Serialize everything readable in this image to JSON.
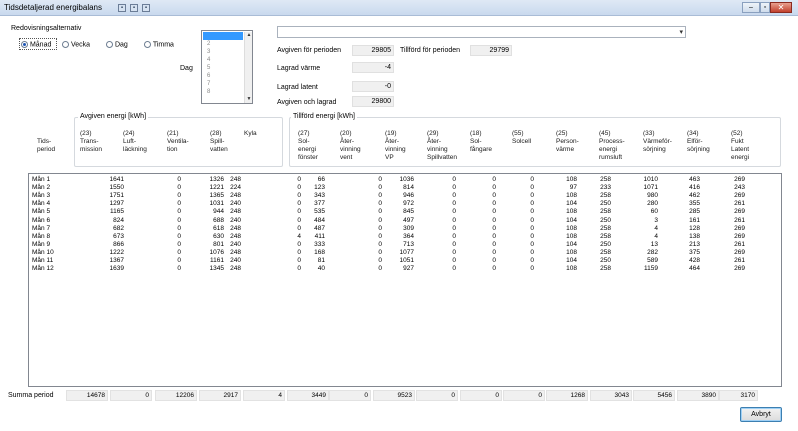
{
  "window": {
    "title": "Tidsdetaljerad energibalans",
    "close_glyph": "✕"
  },
  "options": {
    "group_label": "Redovisningsalternativ",
    "radios": [
      {
        "label": "Månad",
        "selected": true
      },
      {
        "label": "Vecka",
        "selected": false
      },
      {
        "label": "Dag",
        "selected": false
      },
      {
        "label": "Timma",
        "selected": false
      }
    ],
    "day_label": "Dag",
    "day_items": [
      "2",
      "3",
      "4",
      "5",
      "6",
      "7",
      "8"
    ]
  },
  "summary": {
    "avgiven_label": "Avgiven för perioden",
    "avgiven_value": "29805",
    "tillford_label": "Tillförd för perioden",
    "tillford_value": "29799",
    "lagrad_varme_label": "Lagrad värme",
    "lagrad_varme_value": "-4",
    "lagrad_latent_label": "Lagrad latent",
    "lagrad_latent_value": "-0",
    "avgiven_lagrad_label": "Avgiven och lagrad",
    "avgiven_lagrad_value": "29800"
  },
  "headers": {
    "avgiven_group": "Avgiven energi [kWh]",
    "tillford_group": "Tillförd energi [kWh]",
    "period": "Tids-\nperiod",
    "columns": [
      "(23)\nTrans-\nmission",
      "(24)\nLuft-\nläckning",
      "(21)\nVentila-\ntion",
      "(28)\nSpill-\nvatten",
      "Kyla",
      "(27)\nSol-\nenergi\nfönster",
      "(20)\nÅter-\nvinning\nvent",
      "(19)\nÅter-\nvinning\nVP",
      "(29)\nÅter-\nvinning\nSpillvatten",
      "(18)\nSol-\nfångare",
      "(55)\nSolcell",
      "(25)\nPerson-\nvärme",
      "(45)\nProcess-\nenergi\nrumsluft",
      "(33)\nVärmeför-\nsörjning",
      "(34)\nElför-\nsörjning",
      "(52)\nFukt\nLatent\nenergi"
    ]
  },
  "rows": [
    {
      "period": "Mån 1",
      "values": [
        "1641",
        "0",
        "1326",
        "248",
        "0",
        "66",
        "0",
        "1036",
        "0",
        "0",
        "0",
        "108",
        "258",
        "1010",
        "463",
        "269"
      ]
    },
    {
      "period": "Mån 2",
      "values": [
        "1550",
        "0",
        "1221",
        "224",
        "0",
        "123",
        "0",
        "814",
        "0",
        "0",
        "0",
        "97",
        "233",
        "1071",
        "416",
        "243"
      ]
    },
    {
      "period": "Mån 3",
      "values": [
        "1751",
        "0",
        "1365",
        "248",
        "0",
        "343",
        "0",
        "946",
        "0",
        "0",
        "0",
        "108",
        "258",
        "980",
        "462",
        "269"
      ]
    },
    {
      "period": "Mån 4",
      "values": [
        "1297",
        "0",
        "1031",
        "240",
        "0",
        "377",
        "0",
        "972",
        "0",
        "0",
        "0",
        "104",
        "250",
        "280",
        "355",
        "261"
      ]
    },
    {
      "period": "Mån 5",
      "values": [
        "1165",
        "0",
        "944",
        "248",
        "0",
        "535",
        "0",
        "845",
        "0",
        "0",
        "0",
        "108",
        "258",
        "60",
        "285",
        "269"
      ]
    },
    {
      "period": "Mån 6",
      "values": [
        "824",
        "0",
        "688",
        "240",
        "0",
        "484",
        "0",
        "497",
        "0",
        "0",
        "0",
        "104",
        "250",
        "3",
        "161",
        "261"
      ]
    },
    {
      "period": "Mån 7",
      "values": [
        "682",
        "0",
        "618",
        "248",
        "0",
        "487",
        "0",
        "309",
        "0",
        "0",
        "0",
        "108",
        "258",
        "4",
        "128",
        "269"
      ]
    },
    {
      "period": "Mån 8",
      "values": [
        "673",
        "0",
        "630",
        "248",
        "4",
        "411",
        "0",
        "364",
        "0",
        "0",
        "0",
        "108",
        "258",
        "4",
        "138",
        "269"
      ]
    },
    {
      "period": "Mån 9",
      "values": [
        "866",
        "0",
        "801",
        "240",
        "0",
        "333",
        "0",
        "713",
        "0",
        "0",
        "0",
        "104",
        "250",
        "13",
        "213",
        "261"
      ]
    },
    {
      "period": "Mån 10",
      "values": [
        "1222",
        "0",
        "1076",
        "248",
        "0",
        "168",
        "0",
        "1077",
        "0",
        "0",
        "0",
        "108",
        "258",
        "282",
        "375",
        "269"
      ]
    },
    {
      "period": "Mån 11",
      "values": [
        "1367",
        "0",
        "1161",
        "240",
        "0",
        "81",
        "0",
        "1051",
        "0",
        "0",
        "0",
        "104",
        "250",
        "589",
        "428",
        "261"
      ]
    },
    {
      "period": "Mån 12",
      "values": [
        "1639",
        "0",
        "1345",
        "248",
        "0",
        "40",
        "0",
        "927",
        "0",
        "0",
        "0",
        "108",
        "258",
        "1159",
        "464",
        "269"
      ]
    }
  ],
  "totals": {
    "label": "Summa period",
    "values": [
      "14678",
      "0",
      "12206",
      "2917",
      "4",
      "3449",
      "0",
      "9523",
      "0",
      "0",
      "0",
      "1268",
      "3043",
      "5456",
      "3890",
      "3170"
    ]
  },
  "buttons": {
    "cancel": "Avbryt"
  }
}
